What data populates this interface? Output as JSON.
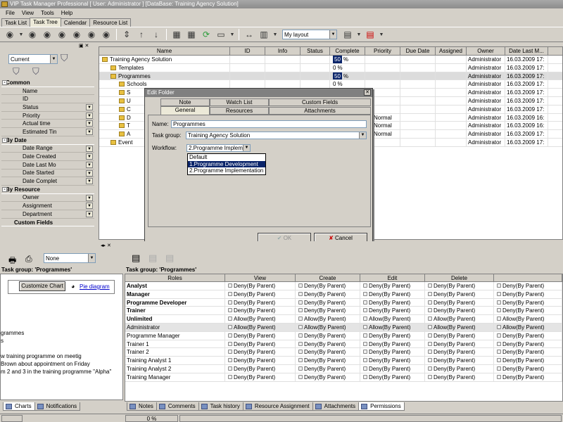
{
  "window": {
    "title": "VIP Task Manager Professional [ User: Administrator ] [DataBase: Training Agency Solution]"
  },
  "menu": [
    "File",
    "View",
    "Tools",
    "Help"
  ],
  "tabs": [
    "Task List",
    "Task Tree",
    "Calendar",
    "Resource List"
  ],
  "toolbar": {
    "layout_value": "My layout"
  },
  "filter": {
    "current_value": "Current",
    "sections": [
      {
        "name": "Common",
        "items": [
          "Name",
          "ID",
          "Status",
          "Priority",
          "Actual time",
          "Estimated Tin"
        ]
      },
      {
        "name": "By Date",
        "items": [
          "Date Range",
          "Date Created",
          "Date Last Mo",
          "Date Started",
          "Date Complet"
        ]
      },
      {
        "name": "By Resource",
        "items": [
          "Owner",
          "Assignment",
          "Department"
        ]
      },
      {
        "name": "Custom Fields",
        "items": []
      }
    ]
  },
  "grid": {
    "columns": [
      "Name",
      "ID",
      "Info",
      "Status",
      "Complete",
      "Priority",
      "Due Date",
      "Assigned",
      "Owner",
      "Date Last M..."
    ],
    "rows": [
      {
        "name": "Training Agency Solution",
        "complete": "50",
        "pct_sign": "%",
        "priority": "",
        "owner": "Administrator",
        "date": "16.03.2009 17:"
      },
      {
        "name": "Templates",
        "complete": "0",
        "pct_sign": "%",
        "priority": "",
        "owner": "Administrator",
        "date": "16.03.2009 17:"
      },
      {
        "name": "Programmes",
        "complete": "50",
        "pct_sign": "%",
        "priority": "",
        "owner": "Administrator",
        "date": "16.03.2009 17:"
      },
      {
        "name": "Schools",
        "complete": "0",
        "pct_sign": "%",
        "priority": "",
        "owner": "Administrator",
        "date": "16.03.2009 17:"
      },
      {
        "name": "S",
        "complete": "",
        "pct_sign": "",
        "priority": "",
        "owner": "Administrator",
        "date": "16.03.2009 17:"
      },
      {
        "name": "U",
        "complete": "",
        "pct_sign": "",
        "priority": "",
        "owner": "Administrator",
        "date": "16.03.2009 17:"
      },
      {
        "name": "C",
        "complete": "",
        "pct_sign": "",
        "priority": "",
        "owner": "Administrator",
        "date": "16.03.2009 17:"
      },
      {
        "name": "D",
        "complete": "",
        "pct_sign": "",
        "priority": "Normal",
        "owner": "Administrator",
        "date": "16.03.2009 16:"
      },
      {
        "name": "T",
        "complete": "",
        "pct_sign": "",
        "priority": "Normal",
        "owner": "Administrator",
        "date": "16.03.2009 16:"
      },
      {
        "name": "A",
        "complete": "",
        "pct_sign": "",
        "priority": "Normal",
        "owner": "Administrator",
        "date": "16.03.2009 17:"
      },
      {
        "name": "Event",
        "complete": "",
        "pct_sign": "",
        "priority": "",
        "owner": "Administrator",
        "date": "16.03.2009 17:"
      }
    ]
  },
  "dialog": {
    "title": "Edit Folder",
    "tabs_top": [
      "Note",
      "Watch List",
      "Custom Fields"
    ],
    "tabs_bottom": [
      "General",
      "Resources",
      "Attachments"
    ],
    "name_label": "Name:",
    "name_value": "Programmes",
    "taskgroup_label": "Task group:",
    "taskgroup_value": "Training Agency Solution",
    "workflow_label": "Workflow:",
    "workflow_value": "2.Programme Implem",
    "workflow_options": [
      "Default",
      "1.Programme Development",
      "2.Programme Implementation"
    ],
    "ok_label": "OK",
    "cancel_label": "Cancel"
  },
  "left_bottom": {
    "none_value": "None",
    "group_title": "Task group: 'Programmes'",
    "customize_label": "Customize Chart",
    "pie_label": "Pie diagram",
    "notes": [
      "grammes",
      "s",
      "",
      "w training programme on meetig",
      "Brown about appointment on Friday",
      "m 2 and 3 in the training programme \"Alpha\""
    ],
    "tabs": [
      "Charts",
      "Notifications"
    ]
  },
  "permissions": {
    "group_title": "Task group: 'Programmes'",
    "columns": [
      "Roles",
      "View",
      "Create",
      "Edit",
      "Delete",
      ""
    ],
    "rows": [
      {
        "role": "Analyst",
        "bold": true,
        "v": "Deny(By Parent)",
        "c": "Deny(By Parent)",
        "e": "Deny(By Parent)",
        "d": "Deny(By Parent)",
        "x": "Deny(By Parent)"
      },
      {
        "role": "Manager",
        "bold": true,
        "v": "Deny(By Parent)",
        "c": "Deny(By Parent)",
        "e": "Deny(By Parent)",
        "d": "Deny(By Parent)",
        "x": "Deny(By Parent)"
      },
      {
        "role": "Programme Developer",
        "bold": true,
        "v": "Deny(By Parent)",
        "c": "Deny(By Parent)",
        "e": "Deny(By Parent)",
        "d": "Deny(By Parent)",
        "x": "Deny(By Parent)"
      },
      {
        "role": "Trainer",
        "bold": true,
        "v": "Deny(By Parent)",
        "c": "Deny(By Parent)",
        "e": "Deny(By Parent)",
        "d": "Deny(By Parent)",
        "x": "Deny(By Parent)"
      },
      {
        "role": "Unlimited",
        "bold": true,
        "v": "Allow(By Parent)",
        "c": "Allow(By Parent)",
        "e": "Allow(By Parent)",
        "d": "Allow(By Parent)",
        "x": "Allow(By Parent)"
      },
      {
        "role": "Administrator",
        "bold": false,
        "hl": true,
        "v": "Allow(By Parent)",
        "c": "Allow(By Parent)",
        "e": "Allow(By Parent)",
        "d": "Allow(By Parent)",
        "x": "Allow(By Parent)"
      },
      {
        "role": "Programme Manager",
        "bold": false,
        "v": "Deny(By Parent)",
        "c": "Deny(By Parent)",
        "e": "Deny(By Parent)",
        "d": "Deny(By Parent)",
        "x": "Deny(By Parent)"
      },
      {
        "role": "Trainer 1",
        "bold": false,
        "v": "Deny(By Parent)",
        "c": "Deny(By Parent)",
        "e": "Deny(By Parent)",
        "d": "Deny(By Parent)",
        "x": "Deny(By Parent)"
      },
      {
        "role": "Trainer 2",
        "bold": false,
        "v": "Deny(By Parent)",
        "c": "Deny(By Parent)",
        "e": "Deny(By Parent)",
        "d": "Deny(By Parent)",
        "x": "Deny(By Parent)"
      },
      {
        "role": "Training Analyst 1",
        "bold": false,
        "v": "Deny(By Parent)",
        "c": "Deny(By Parent)",
        "e": "Deny(By Parent)",
        "d": "Deny(By Parent)",
        "x": "Deny(By Parent)"
      },
      {
        "role": "Training Analyst 2",
        "bold": false,
        "v": "Deny(By Parent)",
        "c": "Deny(By Parent)",
        "e": "Deny(By Parent)",
        "d": "Deny(By Parent)",
        "x": "Deny(By Parent)"
      },
      {
        "role": "Training Manager",
        "bold": false,
        "v": "Deny(By Parent)",
        "c": "Deny(By Parent)",
        "e": "Deny(By Parent)",
        "d": "Deny(By Parent)",
        "x": "Deny(By Parent)"
      }
    ],
    "tabs": [
      "Notes",
      "Comments",
      "Task history",
      "Resource Assignment",
      "Attachments",
      "Permissions"
    ]
  },
  "status": {
    "progress": "0 %"
  },
  "colors": {
    "selection": "#0a246a",
    "normal_priority": "#2da82d"
  }
}
